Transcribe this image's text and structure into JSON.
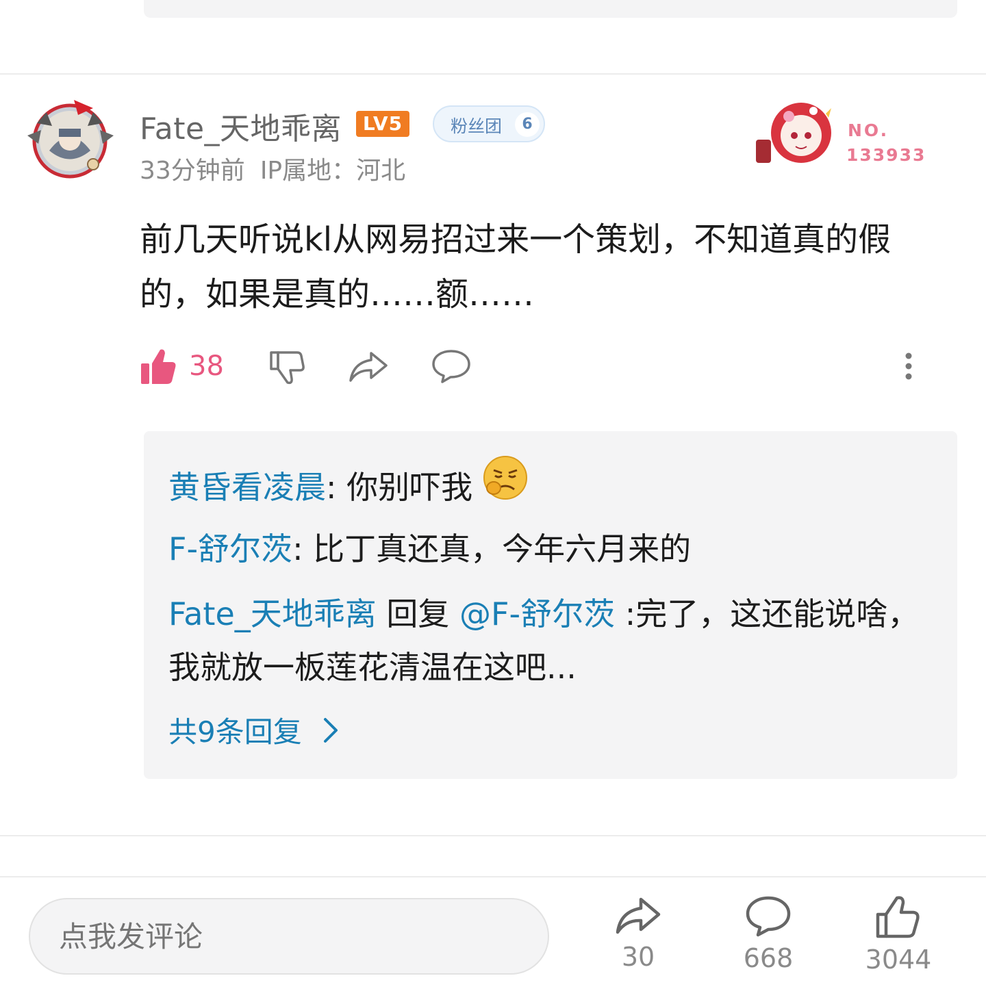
{
  "comment": {
    "username": "Fate_天地乖离",
    "level_badge": "LV5",
    "fans_club": {
      "label": "粉丝团",
      "level": "6"
    },
    "time": "33分钟前",
    "ip_location": "IP属地：河北",
    "decoration": {
      "no_label": "NO.",
      "no_value": "133933"
    },
    "content": "前几天听说kl从网易招过来一个策划，不知道真的假的，如果是真的……额……",
    "like_count": "38",
    "icons": {
      "like": "thumbs-up-filled-icon",
      "dislike": "thumbs-down-icon",
      "share": "share-arrow-icon",
      "comment": "comment-bubble-icon",
      "more": "more-vertical-icon"
    }
  },
  "replies": [
    {
      "author": "黄昏看凌晨",
      "text": ": 你别吓我",
      "emoji": "frowning-face-emoji"
    },
    {
      "author": "F-舒尔茨",
      "text": ": 比丁真还真，今年六月来的"
    },
    {
      "author": "Fate_天地乖离",
      "reply_word": " 回复 ",
      "mention": "@F-舒尔茨",
      "text": " :完了，这还能说啥，我就放一板莲花清温在这吧..."
    }
  ],
  "more_replies_label": "共9条回复",
  "bottom_bar": {
    "input_placeholder": "点我发评论",
    "share_count": "30",
    "comment_count": "668",
    "like_count": "3044"
  },
  "colors": {
    "link_blue": "#1a7fb5",
    "like_pink": "#e8577f",
    "level_orange": "#f07c22",
    "reply_bg": "#f4f4f5"
  }
}
